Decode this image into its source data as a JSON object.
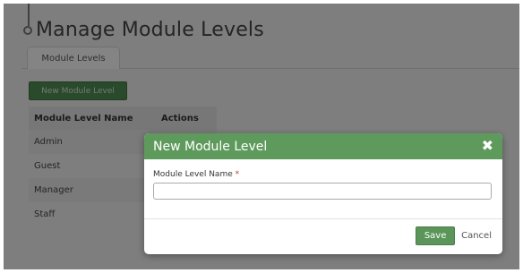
{
  "page": {
    "title": "Manage Module Levels"
  },
  "tabs": [
    {
      "label": "Module Levels"
    }
  ],
  "toolbar": {
    "new_button_label": "New Module Level"
  },
  "table": {
    "headers": [
      "Module Level Name",
      "Actions"
    ],
    "rows": [
      {
        "name": "Admin"
      },
      {
        "name": "Guest"
      },
      {
        "name": "Manager"
      },
      {
        "name": "Staff"
      }
    ]
  },
  "modal": {
    "title": "New Module Level",
    "close_icon": "close-icon",
    "field_label": "Module Level Name",
    "required_marker": "*",
    "field_value": "",
    "save_label": "Save",
    "cancel_label": "Cancel"
  },
  "colors": {
    "accent_green": "#5f9a5d",
    "button_green": "#4f8a52"
  }
}
